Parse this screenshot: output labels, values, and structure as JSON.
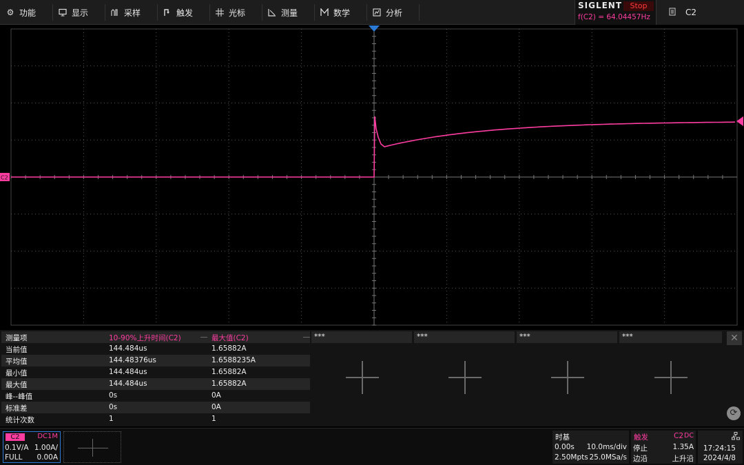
{
  "menu": [
    {
      "label": "功能",
      "icon": "gear-icon"
    },
    {
      "label": "显示",
      "icon": "monitor-icon"
    },
    {
      "label": "采样",
      "icon": "acquire-icon"
    },
    {
      "label": "触发",
      "icon": "trigger-icon"
    },
    {
      "label": "光标",
      "icon": "cursor-icon"
    },
    {
      "label": "测量",
      "icon": "measure-icon"
    },
    {
      "label": "数学",
      "icon": "math-icon"
    },
    {
      "label": "分析",
      "icon": "analysis-icon"
    }
  ],
  "brand": "SIGLENT",
  "run_state": "Stop",
  "frequency_readout": "f(C2) = 64.04457Hz",
  "active_channel": "C2",
  "channel_marker": "C2",
  "colors": {
    "trace": "#ff3da1",
    "grid": "#555555",
    "trigger": "#2b7bd6"
  },
  "measurements": {
    "headers": [
      "测量项",
      "10-90%上升时间(C2)",
      "最大值(C2)"
    ],
    "rows": [
      [
        "当前值",
        "144.484us",
        "1.65882A"
      ],
      [
        "平均值",
        "144.48376us",
        "1.6588235A"
      ],
      [
        "最小值",
        "144.484us",
        "1.65882A"
      ],
      [
        "最大值",
        "144.484us",
        "1.65882A"
      ],
      [
        "峰--峰值",
        "0s",
        "0A"
      ],
      [
        "标准差",
        "0s",
        "0A"
      ],
      [
        "统计次数",
        "1",
        "1"
      ]
    ],
    "empty_slots": [
      "***",
      "***",
      "***",
      "***"
    ]
  },
  "channel_box": {
    "tag": "C2",
    "coupling": "DC1M",
    "scale": "0.1V/A",
    "probe": "1.00A/",
    "bandwidth": "FULL",
    "offset": "0.00A"
  },
  "timebase": {
    "title": "时基",
    "delay": "0.00s",
    "scale": "10.0ms/div",
    "memory": "2.50Mpts",
    "sample_rate": "25.0MSa/s"
  },
  "trigger": {
    "title": "触发",
    "source": "C2",
    "coupling": "DC",
    "mode": "停止",
    "level": "1.35A",
    "type": "边沿",
    "slope": "上升沿"
  },
  "clock": {
    "time": "17:24:15",
    "date": "2024/4/8"
  }
}
